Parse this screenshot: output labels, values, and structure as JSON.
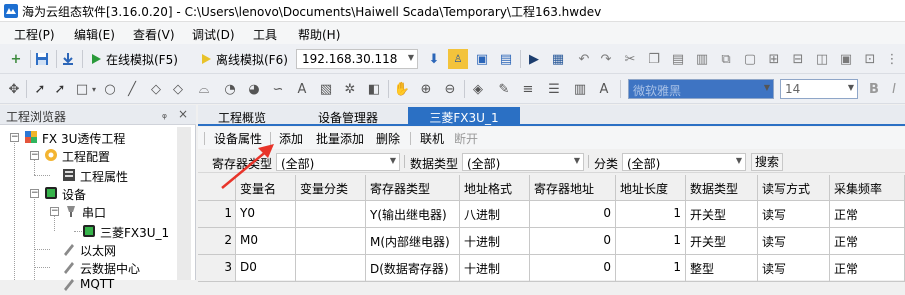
{
  "window": {
    "title": "海为云组态软件[3.16.0.20] - C:\\Users\\lenovo\\Documents\\Haiwell Scada\\Temporary\\工程163.hwdev"
  },
  "menu": [
    "工程(P)",
    "编辑(E)",
    "查看(V)",
    "调试(D)",
    "工具",
    "帮助(H)"
  ],
  "toolbar": {
    "online_sim": "在线模拟(F5)",
    "offline_sim": "离线模拟(F6)",
    "ip_value": "192.168.30.118",
    "font_name": "微软雅黑",
    "font_size": "14"
  },
  "left_pane": {
    "title": "工程浏览器",
    "pin_glyph": "ᵩ",
    "close_glyph": "×",
    "tree": [
      {
        "label": "FX 3U透传工程",
        "icon": "project-icon"
      },
      {
        "label": "工程配置",
        "icon": "gear-icon"
      },
      {
        "label": "工程属性",
        "icon": "property-icon"
      },
      {
        "label": "设备",
        "icon": "device-icon"
      },
      {
        "label": "串口",
        "icon": "serial-port-icon"
      },
      {
        "label": "三菱FX3U_1",
        "icon": "plc-icon"
      },
      {
        "label": "以太网",
        "icon": "ethernet-icon"
      },
      {
        "label": "云数据中心",
        "icon": "cloud-icon"
      },
      {
        "label": "MQTT",
        "icon": "mqtt-icon"
      }
    ]
  },
  "tabs": [
    "工程概览",
    "设备管理器",
    "三菱FX3U_1"
  ],
  "active_tab": 2,
  "commands": [
    {
      "label": "设备属性",
      "enabled": true
    },
    {
      "label": "添加",
      "enabled": true
    },
    {
      "label": "批量添加",
      "enabled": true
    },
    {
      "label": "删除",
      "enabled": true
    },
    {
      "label": "联机",
      "enabled": true
    },
    {
      "label": "断开",
      "enabled": false
    }
  ],
  "filters": {
    "register_type_label": "寄存器类型",
    "register_type_value": "(全部)",
    "data_type_label": "数据类型",
    "data_type_value": "(全部)",
    "category_label": "分类",
    "category_value": "(全部)",
    "search_label": "搜索"
  },
  "table": {
    "columns": [
      "变量名",
      "变量分类",
      "寄存器类型",
      "地址格式",
      "寄存器地址",
      "地址长度",
      "数据类型",
      "读写方式",
      "采集频率"
    ],
    "rows": [
      {
        "num": "1",
        "name": "Y0",
        "category": "",
        "register_type": "Y(输出继电器)",
        "address_format": "八进制",
        "address": "0",
        "length": "1",
        "data_type": "开关型",
        "rw": "读写",
        "frequency": "正常"
      },
      {
        "num": "2",
        "name": "M0",
        "category": "",
        "register_type": "M(内部继电器)",
        "address_format": "十进制",
        "address": "0",
        "length": "1",
        "data_type": "开关型",
        "rw": "读写",
        "frequency": "正常"
      },
      {
        "num": "3",
        "name": "D0",
        "category": "",
        "register_type": "D(数据寄存器)",
        "address_format": "十进制",
        "address": "0",
        "length": "1",
        "data_type": "整型",
        "rw": "读写",
        "frequency": "正常"
      }
    ]
  },
  "colors": {
    "accent": "#2b70c4",
    "annotation_arrow": "#e8342a"
  }
}
